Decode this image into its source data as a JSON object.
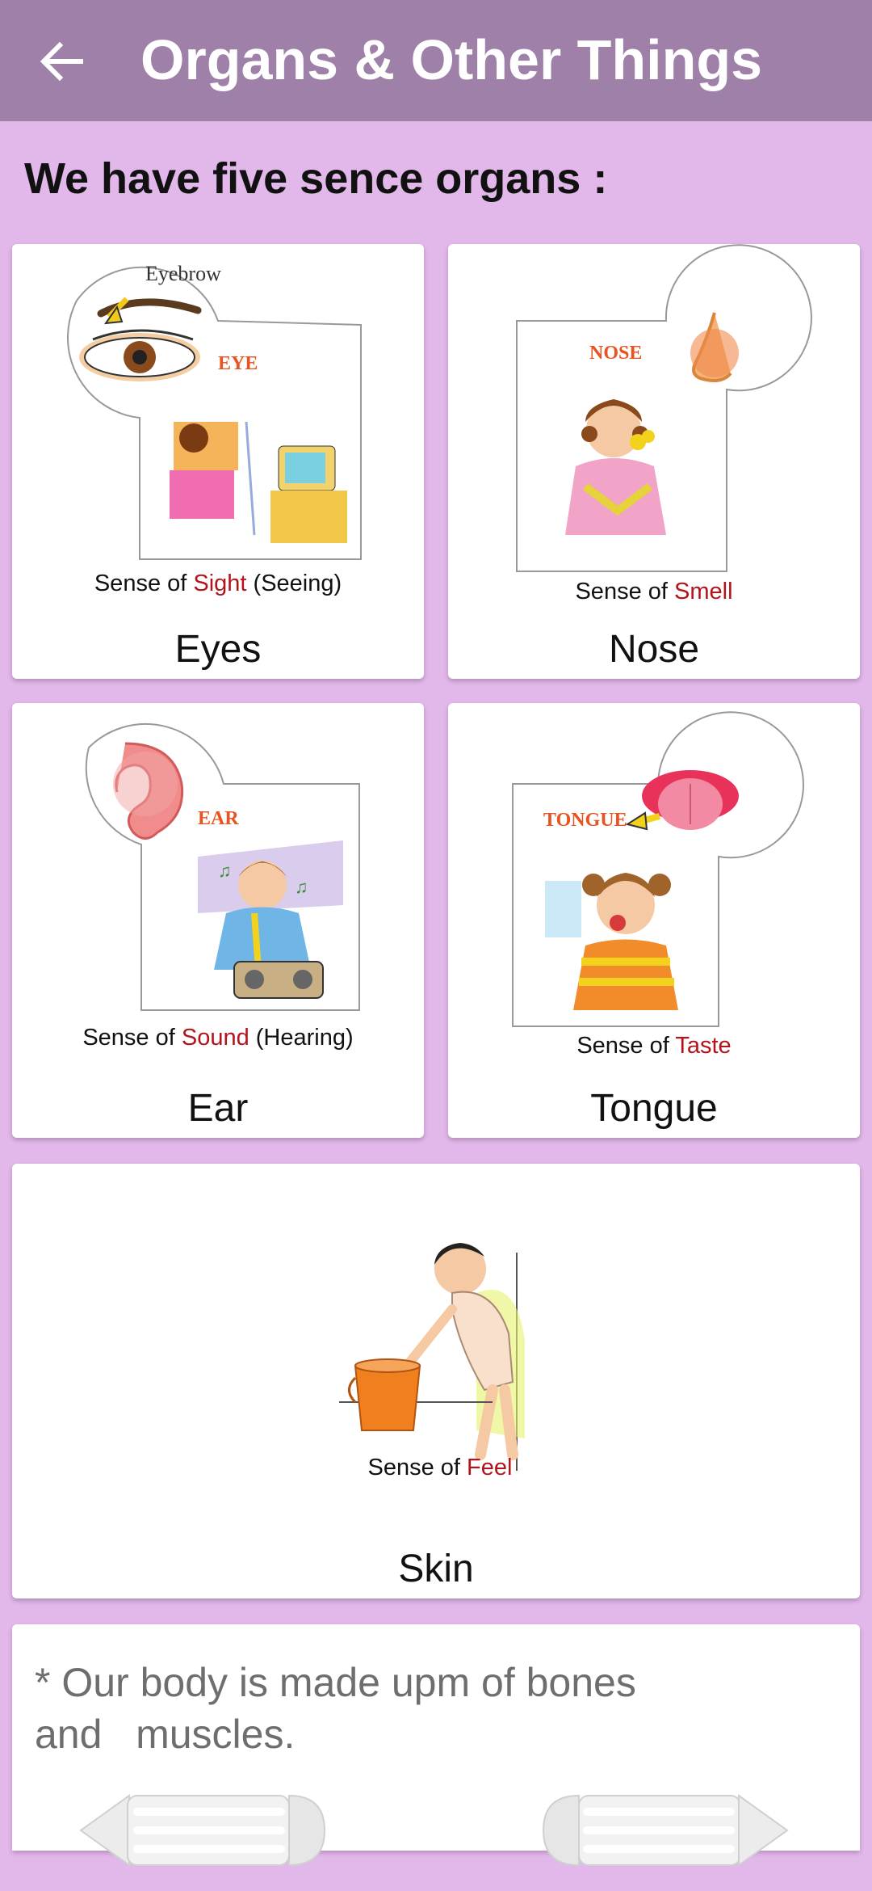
{
  "appbar": {
    "title": "Organs & Other Things",
    "back_icon": "arrow-left-icon"
  },
  "heading": "We have five sence organs :",
  "cards": [
    {
      "caption": "Eyes",
      "sense_prefix": "Sense of ",
      "sense_word": "Sight",
      "sense_suffix": " (Seeing)",
      "tag": "EYE",
      "extra_label": "Eyebrow"
    },
    {
      "caption": "Nose",
      "sense_prefix": "Sense of ",
      "sense_word": "Smell",
      "sense_suffix": "",
      "tag": "NOSE"
    },
    {
      "caption": "Ear",
      "sense_prefix": "Sense of ",
      "sense_word": "Sound",
      "sense_suffix": " (Hearing)",
      "tag": "EAR"
    },
    {
      "caption": "Tongue",
      "sense_prefix": "Sense of ",
      "sense_word": "Taste",
      "sense_suffix": "",
      "tag": "TONGUE"
    },
    {
      "caption": "Skin",
      "sense_prefix": "Sense of ",
      "sense_word": "Feel",
      "sense_suffix": ""
    }
  ],
  "note": "* Our body is made upm of bones and   muscles.",
  "nav": {
    "prev_icon": "pencil-arrow-left-icon",
    "next_icon": "pencil-arrow-right-icon"
  },
  "colors": {
    "appbar": "#9f80a8",
    "background": "#e2b7ea",
    "sense_highlight": "#b3141b",
    "tag_orange": "#e8531f"
  }
}
